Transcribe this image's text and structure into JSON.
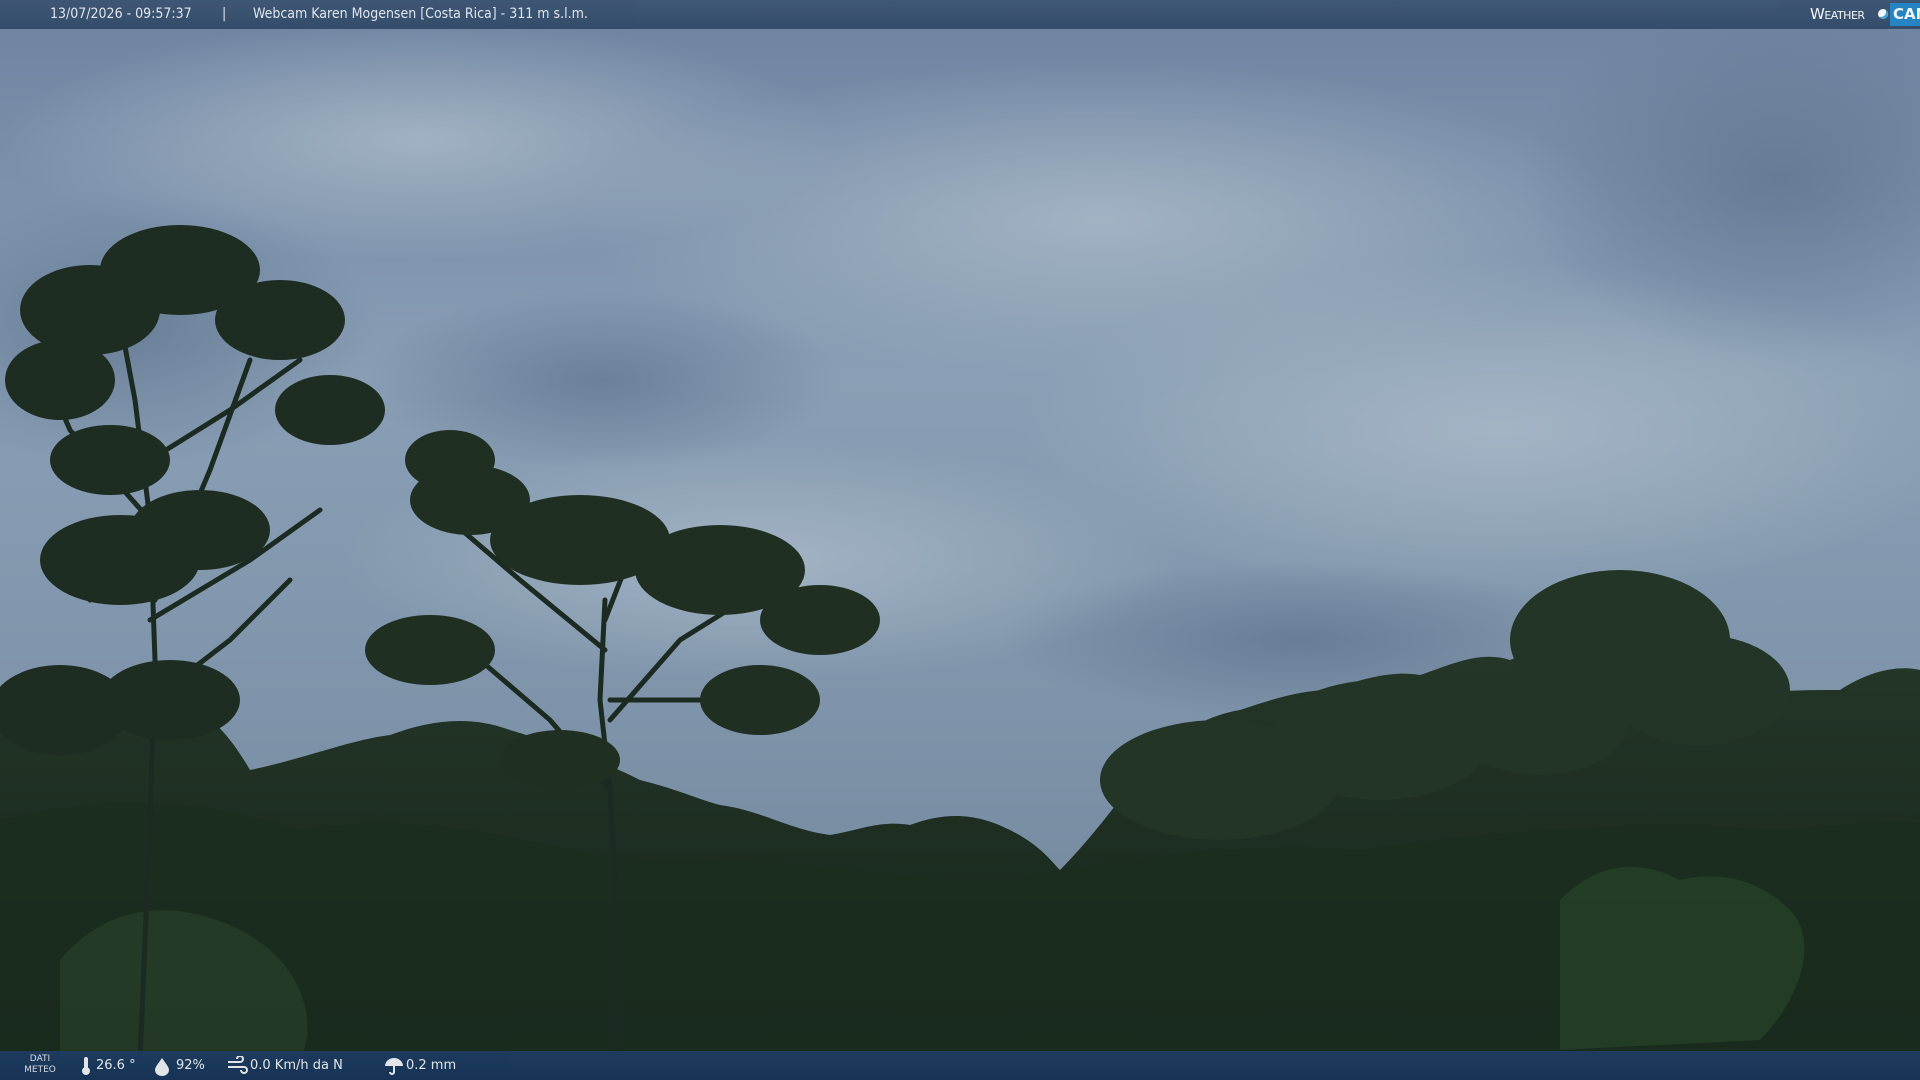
{
  "header": {
    "datetime": "13/07/2026 - 09:57:37",
    "separator": "|",
    "title": "Webcam Karen Mogensen [Costa Rica]  - 311 m s.l.m."
  },
  "logo": {
    "word1": "Weather",
    "word2": "CAM"
  },
  "weather": {
    "label_line1": "DATI",
    "label_line2": "METEO",
    "temperature": "26.6 °",
    "humidity": "92%",
    "wind": "0.0 Km/h da N",
    "rain": "0.2 mm"
  },
  "colors": {
    "sky": "#7f93a8",
    "forest": "#1f3321",
    "bar_top": "#34506e",
    "bar_bottom": "#1a3a60"
  }
}
